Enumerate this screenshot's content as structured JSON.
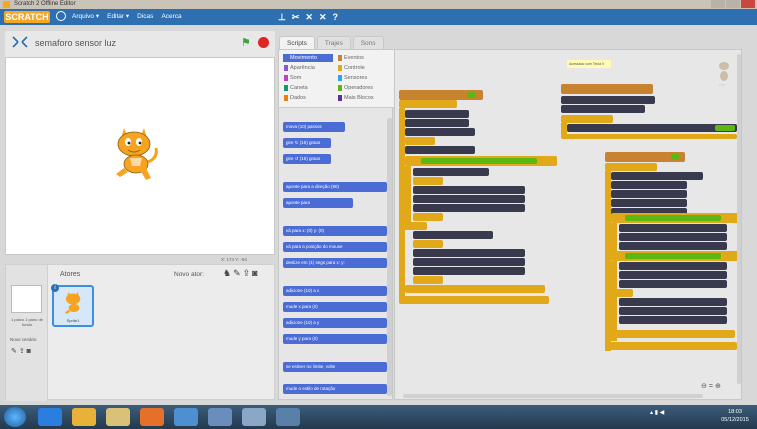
{
  "window": {
    "title": "Scratch 2 Offline Editor"
  },
  "menubar": {
    "logo": "SCRATCH",
    "items": [
      "Arquivo ▾",
      "Editar ▾",
      "Dicas",
      "Acerca"
    ]
  },
  "stage": {
    "project_title": "semaforo sensor luz",
    "coords": "X: 174  Y: -94"
  },
  "sprites_pane": {
    "title": "Atores",
    "new_sprite_label": "Novo ator:",
    "stage_label": "1 palco\n1 pano de fundo",
    "new_backdrop_label": "Novo cenário",
    "sprite_name": "Sprite1"
  },
  "tabs": [
    "Scripts",
    "Trajes",
    "Sons"
  ],
  "palette": {
    "categories": [
      {
        "label": "Movimento",
        "color": "#4a6cd4"
      },
      {
        "label": "Eventos",
        "color": "#c88330"
      },
      {
        "label": "Aparência",
        "color": "#8a55d7"
      },
      {
        "label": "Controle",
        "color": "#e1a91a"
      },
      {
        "label": "Som",
        "color": "#bb42c3"
      },
      {
        "label": "Sensores",
        "color": "#2ca5e2"
      },
      {
        "label": "Caneta",
        "color": "#0e9a6c"
      },
      {
        "label": "Operadores",
        "color": "#5cb712"
      },
      {
        "label": "Dados",
        "color": "#ee7d16"
      },
      {
        "label": "Mais Blocos",
        "color": "#632d99"
      }
    ],
    "blocks": [
      "mova (10) passos",
      "gire ↻ (15) graus",
      "gire ↺ (15) graus",
      "aponte para a direção (90)",
      "aponte para",
      "vá para x: (0) y: (0)",
      "vá para a posição do mouse",
      "deslize em (1) segs para x: y:",
      "adicione (10) a x",
      "mude x para (0)",
      "adicione (10) a y",
      "mude y para (0)",
      "se estiver no limite, volte",
      "mude o estilo de rotação"
    ]
  },
  "scripts": {
    "comment": "Acessado com Tecla 0"
  },
  "taskbar": {
    "time": "18:03",
    "date": "05/12/2015"
  }
}
